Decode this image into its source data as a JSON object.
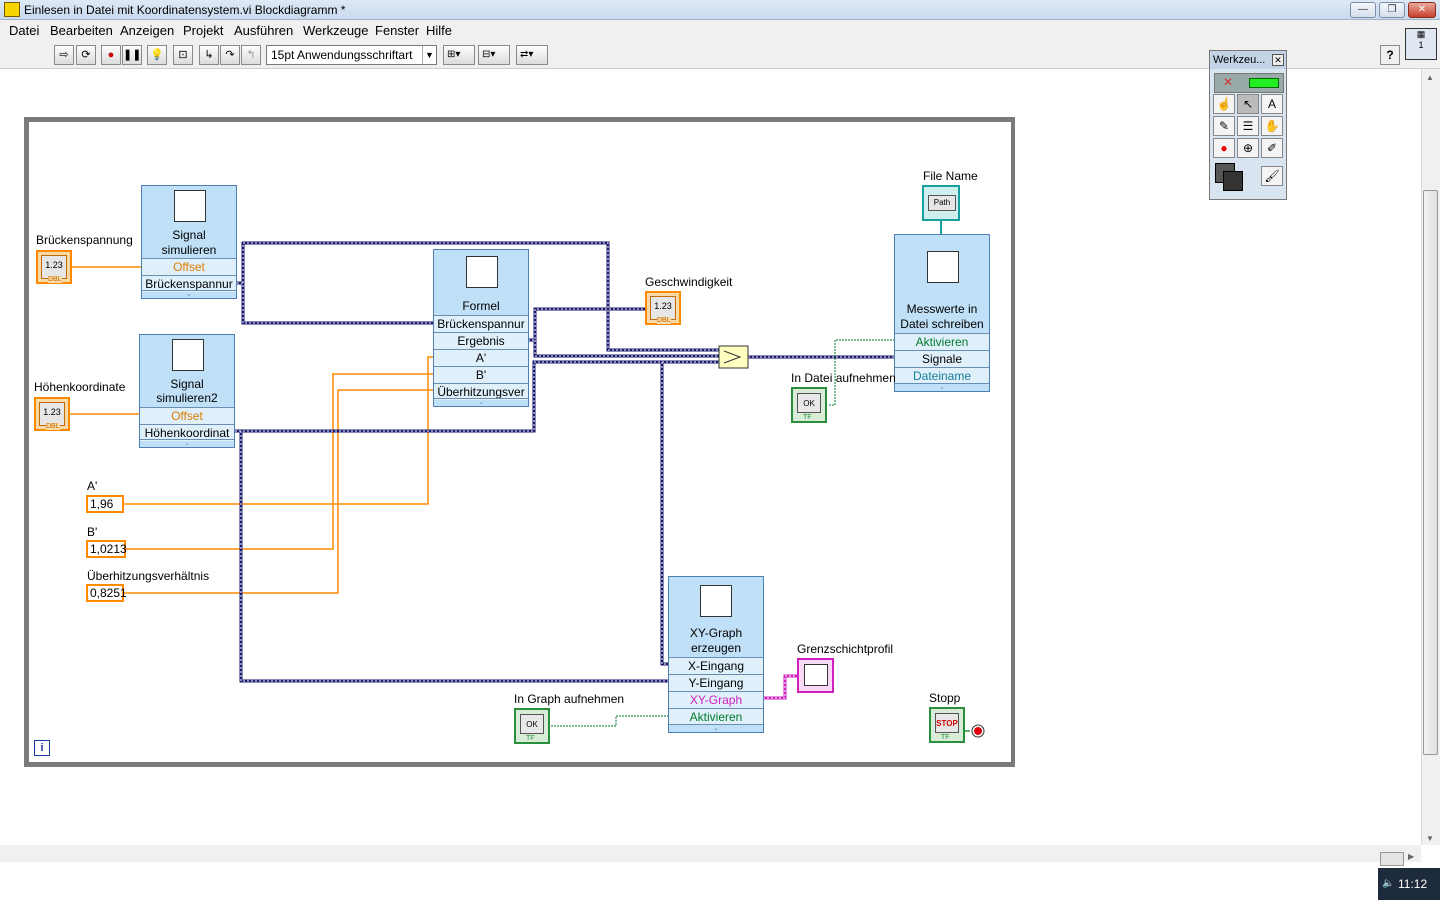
{
  "window": {
    "title": "Einlesen in Datei mit Koordinatensystem.vi Blockdiagramm *"
  },
  "menu": [
    "Datei",
    "Bearbeiten",
    "Anzeigen",
    "Projekt",
    "Ausführen",
    "Werkzeuge",
    "Fenster",
    "Hilfe"
  ],
  "toolbar": {
    "font_select": "15pt Anwendungsschriftart"
  },
  "help_button": "?",
  "palette": {
    "title": "Werkzeu..."
  },
  "controls": {
    "brueckenspannung": {
      "label": "Brückenspannung",
      "value": "1.23",
      "type": "DBL"
    },
    "hoehenkoordinate": {
      "label": "Höhenkoordinate",
      "value": "1.23",
      "type": "DBL"
    },
    "geschwindigkeit": {
      "label": "Geschwindigkeit",
      "value": "1.23",
      "type": "DBL"
    },
    "file_name": {
      "label": "File Name",
      "value": "Path"
    },
    "in_datei": {
      "label": "In Datei aufnehmen",
      "value": "OK",
      "type": "TF"
    },
    "in_graph": {
      "label": "In Graph aufnehmen",
      "value": "OK",
      "type": "TF"
    },
    "stopp": {
      "label": "Stopp",
      "value": "STOP",
      "type": "TF"
    },
    "grenzschicht": {
      "label": "Grenzschichtprofil"
    }
  },
  "constants": {
    "a": {
      "label": "A'",
      "value": "1,96"
    },
    "b": {
      "label": "B'",
      "value": "1,0213"
    },
    "ue": {
      "label": "Überhitzungsverhältnis",
      "value": "0,8251"
    }
  },
  "express_vis": {
    "sig1": {
      "name1": "Signal",
      "name2": "simulieren",
      "rows": [
        "Offset",
        "Brückenspannur"
      ]
    },
    "sig2": {
      "name1": "Signal",
      "name2": "simulieren2",
      "rows": [
        "Offset",
        "Höhenkoordinat"
      ]
    },
    "formel": {
      "name1": "Formel",
      "rows": [
        "Brückenspannur",
        "Ergebnis",
        "A'",
        "B'",
        "Überhitzungsver"
      ]
    },
    "mess": {
      "name1": "Messwerte in",
      "name2": "Datei schreiben",
      "rows": [
        "Aktivieren",
        "Signale",
        "Dateiname"
      ]
    },
    "xy": {
      "name1": "XY-Graph",
      "name2": "erzeugen",
      "rows": [
        "X-Eingang",
        "Y-Eingang",
        "XY-Graph",
        "Aktivieren"
      ]
    }
  },
  "loop_info": "i",
  "clock": "11:12"
}
